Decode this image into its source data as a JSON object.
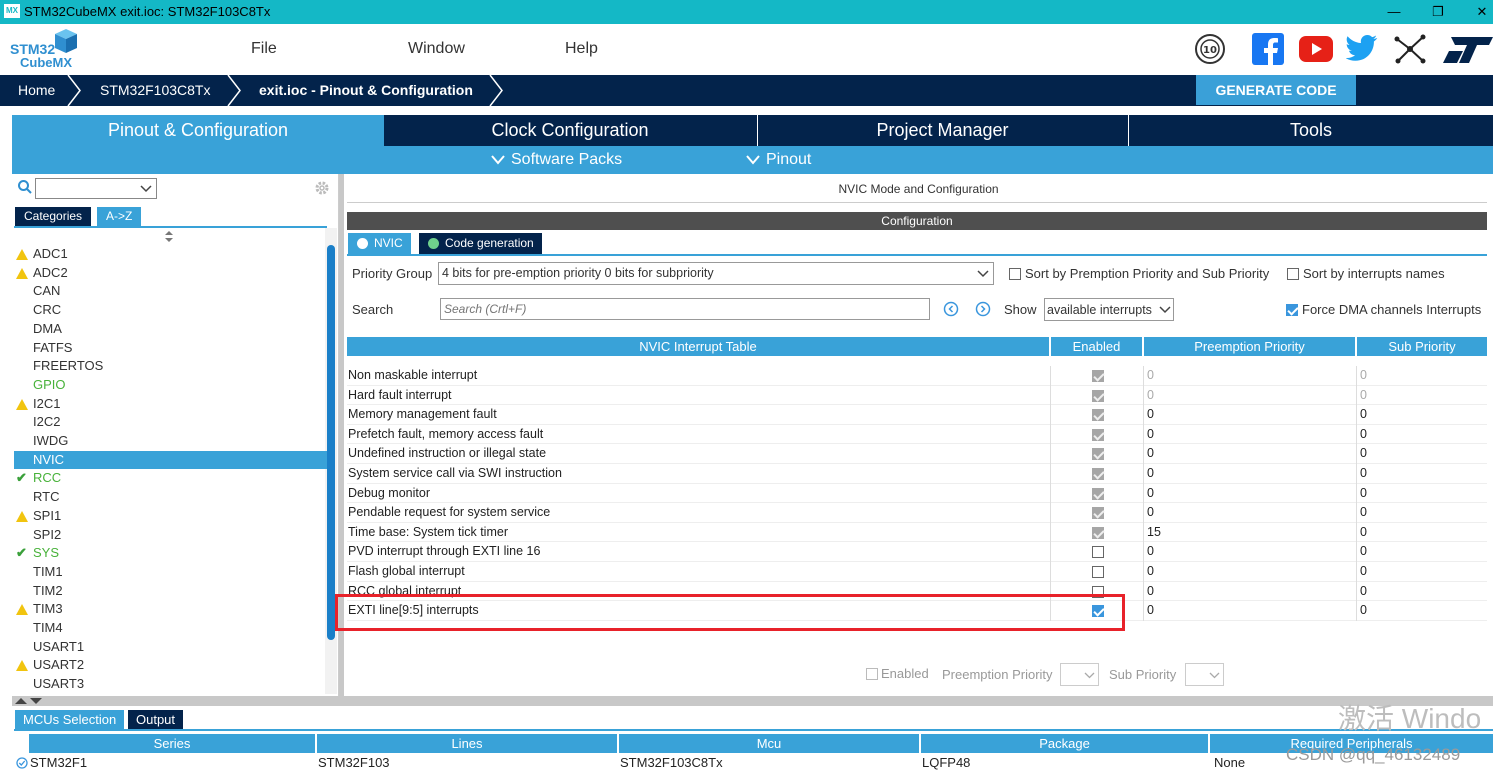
{
  "window": {
    "title": "STM32CubeMX exit.ioc: STM32F103C8Tx",
    "icon_label": "MX",
    "minimize": "—",
    "maximize": "❐",
    "close": "✕"
  },
  "menu": {
    "logo_line1": "STM32",
    "logo_line2": "CubeMX",
    "items": [
      "File",
      "Window",
      "Help"
    ]
  },
  "breadcrumbs": [
    "Home",
    "STM32F103C8Tx",
    "exit.ioc - Pinout & Configuration"
  ],
  "generate_label": "GENERATE CODE",
  "tabs": [
    "Pinout & Configuration",
    "Clock Configuration",
    "Project Manager",
    "Tools"
  ],
  "subtabs": [
    "Software Packs",
    "Pinout"
  ],
  "left": {
    "category_tabs": [
      "Categories",
      "A->Z"
    ],
    "items": [
      {
        "label": "ADC1",
        "status": "warn"
      },
      {
        "label": "ADC2",
        "status": "warn"
      },
      {
        "label": "CAN",
        "status": ""
      },
      {
        "label": "CRC",
        "status": ""
      },
      {
        "label": "DMA",
        "status": ""
      },
      {
        "label": "FATFS",
        "status": ""
      },
      {
        "label": "FREERTOS",
        "status": ""
      },
      {
        "label": "GPIO",
        "status": "green"
      },
      {
        "label": "I2C1",
        "status": "warn"
      },
      {
        "label": "I2C2",
        "status": ""
      },
      {
        "label": "IWDG",
        "status": ""
      },
      {
        "label": "NVIC",
        "status": "selected"
      },
      {
        "label": "RCC",
        "status": "ok"
      },
      {
        "label": "RTC",
        "status": ""
      },
      {
        "label": "SPI1",
        "status": "warn"
      },
      {
        "label": "SPI2",
        "status": ""
      },
      {
        "label": "SYS",
        "status": "ok"
      },
      {
        "label": "TIM1",
        "status": ""
      },
      {
        "label": "TIM2",
        "status": ""
      },
      {
        "label": "TIM3",
        "status": "warn"
      },
      {
        "label": "TIM4",
        "status": ""
      },
      {
        "label": "USART1",
        "status": ""
      },
      {
        "label": "USART2",
        "status": "warn"
      },
      {
        "label": "USART3",
        "status": ""
      }
    ]
  },
  "nvic": {
    "header": "NVIC Mode and Configuration",
    "config_label": "Configuration",
    "tabs": [
      "NVIC",
      "Code generation"
    ],
    "priority_group_label": "Priority Group",
    "priority_group_value": "4 bits for pre-emption priority 0 bits for subpriority",
    "sort_premption_label": "Sort by Premption Priority and Sub Priority",
    "sort_names_label": "Sort by interrupts names",
    "search_label": "Search",
    "search_placeholder": "Search (Crtl+F)",
    "show_label": "Show",
    "show_value": "available interrupts",
    "force_dma_label": "Force DMA channels Interrupts",
    "table_headers": [
      "NVIC Interrupt Table",
      "Enabled",
      "Preemption Priority",
      "Sub Priority"
    ],
    "rows": [
      {
        "name": "Non maskable interrupt",
        "enabled": "locked",
        "pre": "0",
        "sub": "0",
        "dim": true
      },
      {
        "name": "Hard fault interrupt",
        "enabled": "locked",
        "pre": "0",
        "sub": "0",
        "dim": true
      },
      {
        "name": "Memory management fault",
        "enabled": "locked",
        "pre": "0",
        "sub": "0",
        "dim": false
      },
      {
        "name": "Prefetch fault, memory access fault",
        "enabled": "locked",
        "pre": "0",
        "sub": "0",
        "dim": false
      },
      {
        "name": "Undefined instruction or illegal state",
        "enabled": "locked",
        "pre": "0",
        "sub": "0",
        "dim": false
      },
      {
        "name": "System service call via SWI instruction",
        "enabled": "locked",
        "pre": "0",
        "sub": "0",
        "dim": false
      },
      {
        "name": "Debug monitor",
        "enabled": "locked",
        "pre": "0",
        "sub": "0",
        "dim": false
      },
      {
        "name": "Pendable request for system service",
        "enabled": "locked",
        "pre": "0",
        "sub": "0",
        "dim": false
      },
      {
        "name": "Time base: System tick timer",
        "enabled": "locked",
        "pre": "15",
        "sub": "0",
        "dim": false
      },
      {
        "name": "PVD interrupt through EXTI line 16",
        "enabled": "off",
        "pre": "0",
        "sub": "0",
        "dim": false
      },
      {
        "name": "Flash global interrupt",
        "enabled": "off",
        "pre": "0",
        "sub": "0",
        "dim": false
      },
      {
        "name": "RCC global interrupt",
        "enabled": "off",
        "pre": "0",
        "sub": "0",
        "dim": false
      },
      {
        "name": "EXTI line[9:5] interrupts",
        "enabled": "on",
        "pre": "0",
        "sub": "0",
        "dim": false
      }
    ],
    "bottom_enabled_label": "Enabled",
    "bottom_preemption_label": "Preemption Priority",
    "bottom_sub_label": "Sub Priority"
  },
  "bottom": {
    "tabs": [
      "MCUs Selection",
      "Output"
    ],
    "headers": [
      "Series",
      "Lines",
      "Mcu",
      "Package",
      "Required Peripherals"
    ],
    "row": [
      "STM32F1",
      "STM32F103",
      "STM32F103C8Tx",
      "LQFP48",
      "None"
    ]
  },
  "overlay": {
    "activate": "激活 Windo",
    "csdn": "CSDN @qq_46132489"
  },
  "colors": {
    "navy": "#03234b",
    "accent": "#39a2d8",
    "title": "#14b8c6",
    "highlight": "#e8222a"
  }
}
